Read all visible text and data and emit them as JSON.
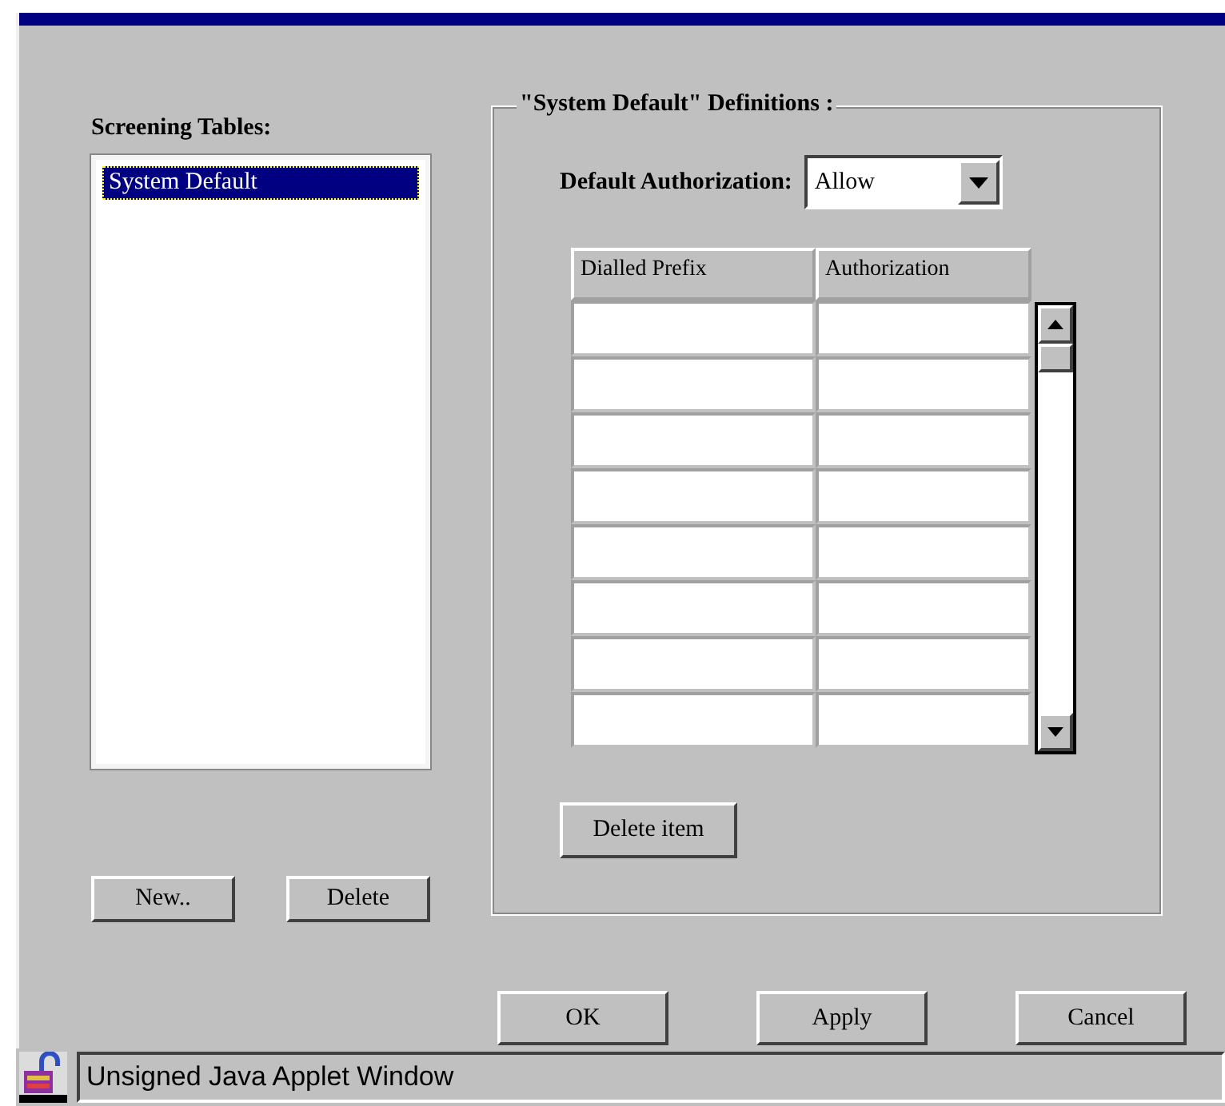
{
  "screening_tables": {
    "label": "Screening Tables:",
    "items": [
      {
        "label": "System Default",
        "selected": true
      }
    ]
  },
  "list_buttons": [
    "New..",
    "Delete"
  ],
  "definitions": {
    "title": "\"System Default\"  Definitions :",
    "default_authorization": {
      "label": "Default Authorization:",
      "value": "Allow"
    },
    "table": {
      "columns": [
        "Dialled Prefix",
        "Authorization"
      ]
    },
    "delete_button": "Delete item"
  },
  "buttons": [
    "OK",
    "Apply",
    "Cancel"
  ],
  "status_bar": "Unsigned Java Applet Window"
}
